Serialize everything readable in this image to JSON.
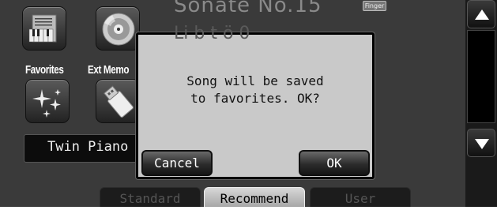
{
  "song": {
    "title": "Sonate No.15",
    "composer": "Li b  t ö  0",
    "finger_badge": "Finger"
  },
  "categories": [
    {
      "label": "",
      "icon": "piano-score-icon"
    },
    {
      "label": "",
      "icon": "disc-icon"
    },
    {
      "label": "Favorites",
      "icon": "sparkle-stars-icon"
    },
    {
      "label": "Ext Memo",
      "icon": "usb-memory-icon"
    }
  ],
  "tone": {
    "label": "Twin Piano"
  },
  "tabs": [
    {
      "label": "Standard",
      "active": false
    },
    {
      "label": "Recommend",
      "active": true
    },
    {
      "label": "User",
      "active": false
    }
  ],
  "scroll": {
    "up_icon": "triangle-up-icon",
    "down_icon": "triangle-down-icon"
  },
  "dialog": {
    "message": "Song will be saved\nto favorites. OK?",
    "cancel_label": "Cancel",
    "ok_label": "OK"
  },
  "colors": {
    "background": "#3a3a3a",
    "dialog_bg": "#c9c9c9",
    "active_tab": "#c8c8c8"
  }
}
